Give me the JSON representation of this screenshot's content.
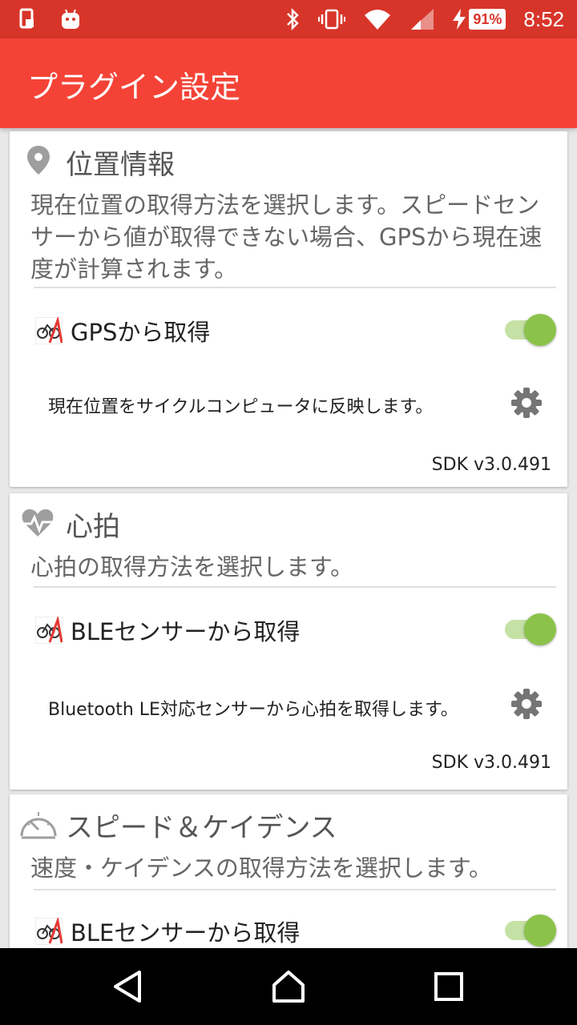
{
  "status_bar": {
    "time": "8:52",
    "battery": "91%",
    "icons": [
      "sim-icon",
      "android-icon",
      "bluetooth-icon",
      "vibrate-icon",
      "wifi-icon",
      "signal-icon",
      "charging-icon"
    ]
  },
  "appbar": {
    "title": "プラグイン設定"
  },
  "colors": {
    "primary": "#f44336",
    "status": "#d8352a",
    "toggle_on": "#8bc34a"
  },
  "cards": [
    {
      "title": "位置情報",
      "icon": "location-pin-icon",
      "description": "現在位置の取得方法を選択します。スピードセンサーから値が取得できない場合、GPSから現在速度が計算されます。",
      "plugin": {
        "name": "GPSから取得",
        "enabled": true,
        "description": "現在位置をサイクルコンピュータに反映します。",
        "sdk": "SDK v3.0.491"
      }
    },
    {
      "title": "心拍",
      "icon": "heart-rate-icon",
      "description": "心拍の取得方法を選択します。",
      "plugin": {
        "name": "BLEセンサーから取得",
        "enabled": true,
        "description": "Bluetooth LE対応センサーから心拍を取得します。",
        "sdk": "SDK v3.0.491"
      }
    },
    {
      "title": "スピード＆ケイデンス",
      "icon": "speedometer-icon",
      "description": "速度・ケイデンスの取得方法を選択します。",
      "plugin": {
        "name": "BLEセンサーから取得",
        "enabled": true
      }
    }
  ]
}
